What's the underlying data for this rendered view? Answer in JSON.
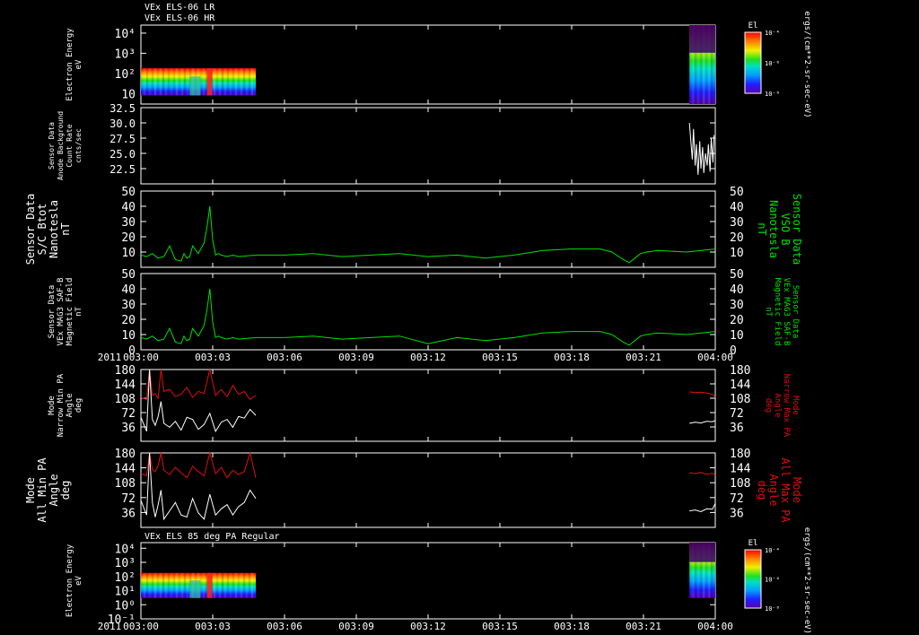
{
  "header": {
    "title_lr": "VEx ELS-06 LR",
    "title_hr": "VEx ELS-06 HR",
    "title_bottom": "VEx ELS 85 deg PA Regular"
  },
  "time_axis": {
    "year": "2011",
    "ticks": [
      "003:00",
      "003:03",
      "003:06",
      "003:09",
      "003:12",
      "003:15",
      "003:18",
      "003:21",
      "004:00"
    ]
  },
  "colorbars": {
    "label": "El",
    "unit": "ergs/(cm**2-sr-sec-eV)",
    "ticks": [
      "10⁻⁴",
      "10⁻⁶",
      "10⁻⁸"
    ]
  },
  "chart_data": [
    {
      "id": "p1",
      "type": "heatmap",
      "title": "VEx ELS-06 LR / VEx ELS-06 HR",
      "ylabel": [
        "Electron Energy",
        "eV"
      ],
      "yscale": "log",
      "yticks": [
        "10⁴",
        "10³",
        "10²",
        "10"
      ],
      "ytick_values": [
        10000,
        1000,
        100,
        10
      ],
      "ylim": [
        3,
        25000
      ],
      "xlim": [
        0,
        1
      ],
      "data_blocks": [
        {
          "x": [
            0.0,
            0.2
          ],
          "energy_range": [
            8,
            180
          ]
        },
        {
          "x": [
            0.955,
            1.0
          ],
          "energy_range": [
            3,
            25000
          ]
        }
      ],
      "colorbar_label": "El"
    },
    {
      "id": "p2",
      "type": "line",
      "ylabel": [
        "Sensor Data",
        "Anode Background",
        "Count Rate",
        "cnts/sec"
      ],
      "ylim": [
        20.0,
        32.5
      ],
      "yticks": [
        22.5,
        25.0,
        27.5,
        30.0,
        32.5
      ],
      "series": [
        {
          "color": "#ffffff",
          "x": [
            0.955,
            0.957,
            0.96,
            0.962,
            0.965,
            0.967,
            0.97,
            0.973,
            0.975,
            0.978,
            0.98,
            0.983,
            0.986,
            0.988,
            0.991,
            0.993,
            0.996,
            0.998
          ],
          "values": [
            30.0,
            27.5,
            24.0,
            29.0,
            23.0,
            26.5,
            21.5,
            27.0,
            22.5,
            26.0,
            21.8,
            25.0,
            23.0,
            26.5,
            22.0,
            27.5,
            23.5,
            28.0
          ]
        }
      ]
    },
    {
      "id": "p3",
      "type": "line",
      "ylabel": [
        "Sensor Data",
        "S/C Btot",
        "Nanotesla",
        "nT"
      ],
      "ylabel_right": [
        "Sensor Data",
        "VSO B",
        "Nanotesla",
        "nT"
      ],
      "ylim": [
        0,
        50
      ],
      "yticks": [
        10,
        20,
        30,
        40,
        50
      ],
      "series": [
        {
          "color": "#00e000",
          "x": [
            0.0,
            0.01,
            0.02,
            0.03,
            0.04,
            0.05,
            0.06,
            0.07,
            0.075,
            0.08,
            0.085,
            0.09,
            0.1,
            0.11,
            0.115,
            0.12,
            0.125,
            0.13,
            0.135,
            0.14,
            0.15,
            0.16,
            0.17,
            0.2,
            0.25,
            0.3,
            0.35,
            0.4,
            0.45,
            0.5,
            0.55,
            0.6,
            0.65,
            0.7,
            0.75,
            0.8,
            0.82,
            0.84,
            0.85,
            0.86,
            0.87,
            0.88,
            0.9,
            0.95,
            1.0
          ],
          "values": [
            8,
            7,
            9,
            6,
            7,
            14,
            5,
            4,
            9,
            6,
            7,
            14,
            9,
            16,
            26,
            40,
            18,
            8,
            9,
            8,
            7,
            8,
            7,
            8,
            8,
            9,
            7,
            8,
            9,
            7,
            8,
            6,
            8,
            11,
            12,
            12,
            10,
            5,
            3,
            6,
            9,
            10,
            11,
            10,
            12
          ]
        }
      ]
    },
    {
      "id": "p4",
      "type": "line",
      "ylabel": [
        "Sensor Data",
        "VEx MAG3 SAF-B",
        "Magnetic Field",
        "nT"
      ],
      "ylabel_right": [
        "Sensor Data",
        "VEx MAG3 SAF-B",
        "Magnetic Field",
        "nT"
      ],
      "ylim": [
        0,
        50
      ],
      "yticks": [
        0,
        10,
        20,
        30,
        40,
        50
      ],
      "series": [
        {
          "color": "#00e000",
          "x": [
            0.0,
            0.01,
            0.02,
            0.03,
            0.04,
            0.05,
            0.06,
            0.07,
            0.075,
            0.08,
            0.085,
            0.09,
            0.1,
            0.11,
            0.115,
            0.12,
            0.125,
            0.13,
            0.135,
            0.14,
            0.15,
            0.16,
            0.17,
            0.2,
            0.25,
            0.3,
            0.35,
            0.4,
            0.45,
            0.5,
            0.55,
            0.6,
            0.65,
            0.7,
            0.75,
            0.8,
            0.82,
            0.84,
            0.85,
            0.86,
            0.87,
            0.88,
            0.9,
            0.95,
            1.0
          ],
          "values": [
            8,
            7,
            9,
            6,
            7,
            14,
            5,
            4,
            9,
            6,
            7,
            14,
            9,
            16,
            26,
            40,
            18,
            8,
            9,
            8,
            7,
            8,
            7,
            8,
            8,
            9,
            7,
            8,
            9,
            4,
            8,
            6,
            8,
            11,
            12,
            12,
            10,
            5,
            3,
            6,
            9,
            10,
            11,
            10,
            12
          ]
        }
      ]
    },
    {
      "id": "p5",
      "type": "line",
      "ylabel": [
        "Mode",
        "Narrow Min PA",
        "Angle",
        "deg"
      ],
      "ylabel_right": [
        "Mode",
        "Narrow Max PA",
        "Angle",
        "deg"
      ],
      "ylim": [
        0,
        180
      ],
      "yticks": [
        36,
        72,
        108,
        144,
        180
      ],
      "series": [
        {
          "color": "#e01010",
          "x": [
            0.0,
            0.01,
            0.015,
            0.02,
            0.025,
            0.03,
            0.035,
            0.04,
            0.05,
            0.06,
            0.07,
            0.08,
            0.09,
            0.1,
            0.11,
            0.12,
            0.13,
            0.14,
            0.15,
            0.16,
            0.17,
            0.18,
            0.19,
            0.2
          ],
          "values": [
            110,
            105,
            180,
            115,
            120,
            108,
            180,
            125,
            130,
            112,
            118,
            135,
            110,
            125,
            120,
            180,
            115,
            130,
            112,
            140,
            118,
            125,
            105,
            115
          ]
        },
        {
          "color": "#ffffff",
          "x": [
            0.0,
            0.01,
            0.015,
            0.02,
            0.025,
            0.03,
            0.035,
            0.04,
            0.05,
            0.06,
            0.07,
            0.08,
            0.09,
            0.1,
            0.11,
            0.12,
            0.13,
            0.14,
            0.15,
            0.16,
            0.17,
            0.18,
            0.19,
            0.2
          ],
          "values": [
            60,
            25,
            180,
            55,
            40,
            62,
            100,
            45,
            35,
            50,
            28,
            60,
            55,
            30,
            42,
            70,
            25,
            48,
            55,
            35,
            62,
            58,
            80,
            65
          ]
        },
        {
          "color": "#e01010",
          "x": [
            0.955,
            0.965,
            0.975,
            0.985,
            0.995,
            1.0
          ],
          "values": [
            124,
            122,
            123,
            121,
            118,
            110
          ]
        },
        {
          "color": "#ffffff",
          "x": [
            0.955,
            0.965,
            0.975,
            0.985,
            0.995,
            1.0
          ],
          "values": [
            45,
            48,
            46,
            50,
            49,
            52
          ]
        }
      ]
    },
    {
      "id": "p6",
      "type": "line",
      "ylabel": [
        "Mode",
        "All Min PA",
        "Angle",
        "deg"
      ],
      "ylabel_right": [
        "Mode",
        "All Max PA",
        "Angle",
        "deg"
      ],
      "ylim": [
        0,
        180
      ],
      "yticks": [
        36,
        72,
        108,
        144,
        180
      ],
      "series": [
        {
          "color": "#e01010",
          "x": [
            0.0,
            0.01,
            0.015,
            0.02,
            0.025,
            0.03,
            0.035,
            0.04,
            0.05,
            0.06,
            0.07,
            0.08,
            0.09,
            0.1,
            0.11,
            0.12,
            0.13,
            0.14,
            0.15,
            0.16,
            0.17,
            0.18,
            0.19,
            0.2
          ],
          "values": [
            130,
            125,
            180,
            140,
            135,
            150,
            180,
            138,
            128,
            145,
            132,
            120,
            148,
            135,
            125,
            180,
            130,
            145,
            120,
            138,
            128,
            135,
            180,
            120
          ]
        },
        {
          "color": "#ffffff",
          "x": [
            0.0,
            0.01,
            0.015,
            0.02,
            0.025,
            0.03,
            0.035,
            0.04,
            0.05,
            0.06,
            0.07,
            0.08,
            0.09,
            0.1,
            0.11,
            0.12,
            0.13,
            0.14,
            0.15,
            0.16,
            0.17,
            0.18,
            0.19,
            0.2
          ],
          "values": [
            65,
            30,
            180,
            60,
            25,
            55,
            90,
            20,
            40,
            60,
            30,
            25,
            70,
            35,
            20,
            80,
            30,
            45,
            55,
            30,
            50,
            60,
            90,
            70
          ]
        },
        {
          "color": "#e01010",
          "x": [
            0.955,
            0.965,
            0.975,
            0.985,
            0.995,
            1.0
          ],
          "values": [
            132,
            130,
            133,
            128,
            131,
            126
          ]
        },
        {
          "color": "#ffffff",
          "x": [
            0.955,
            0.965,
            0.975,
            0.985,
            0.995,
            1.0
          ],
          "values": [
            40,
            42,
            38,
            45,
            44,
            58
          ]
        }
      ]
    },
    {
      "id": "p7",
      "type": "heatmap",
      "title": "VEx ELS 85 deg PA Regular",
      "ylabel": [
        "Electron Energy",
        "eV"
      ],
      "yscale": "log",
      "yticks": [
        "10⁴",
        "10³",
        "10²",
        "10¹",
        "10⁰",
        "10⁻¹"
      ],
      "ytick_values": [
        10000,
        1000,
        100,
        10,
        1,
        0.1
      ],
      "ylim": [
        0.1,
        25000
      ],
      "xlim": [
        0,
        1
      ],
      "data_blocks": [
        {
          "x": [
            0.0,
            0.2
          ],
          "energy_range": [
            3,
            180
          ]
        },
        {
          "x": [
            0.955,
            1.0
          ],
          "energy_range": [
            3,
            25000
          ]
        }
      ],
      "colorbar_label": "El"
    }
  ]
}
